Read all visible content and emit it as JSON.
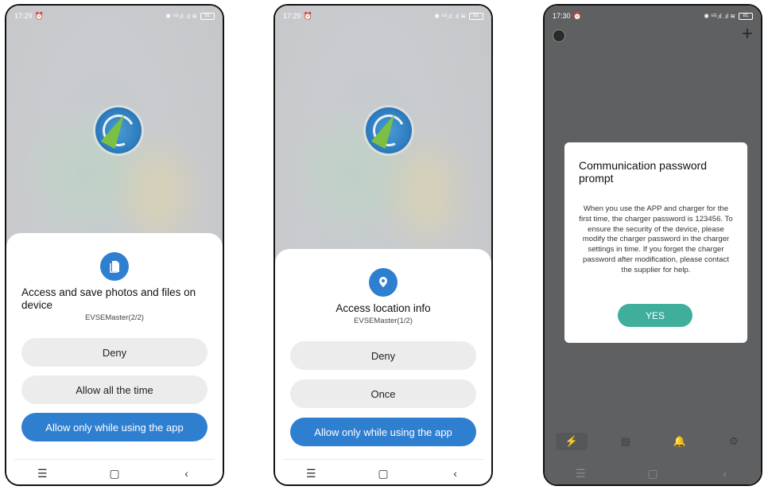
{
  "phone1": {
    "status": {
      "time": "17:29",
      "alarm_icon": "alarm-icon",
      "right": "✱ ⁵ᴳ.ıl .ıl ≋",
      "battery": "81"
    },
    "permission": {
      "icon": "file-icon",
      "title": "Access and save photos and files on device",
      "subtitle": "EVSEMaster(2/2)",
      "buttons": [
        "Deny",
        "Allow all the time",
        "Allow only while using the app"
      ]
    },
    "nav": {
      "menu": "☰",
      "home": "▢",
      "back": "‹"
    }
  },
  "phone2": {
    "status": {
      "time": "17:29",
      "alarm_icon": "alarm-icon",
      "right": "✱ ⁵ᴳ.ıl .ıl ≋",
      "battery": "81"
    },
    "permission": {
      "icon": "location-icon",
      "title": "Access location info",
      "subtitle": "EVSEMaster(1/2)",
      "buttons": [
        "Deny",
        "Once",
        "Allow only while using the app"
      ]
    },
    "nav": {
      "menu": "☰",
      "home": "▢",
      "back": "‹"
    }
  },
  "phone3": {
    "status": {
      "time": "17:30",
      "alarm_icon": "alarm-icon",
      "right": "✱ ⁵ᴳ.ıl .ıl ≋",
      "battery": "81"
    },
    "header": {
      "plus": "+"
    },
    "dialog": {
      "title": "Communication password prompt",
      "body": "When you use the APP and charger for the first time, the charger password is 123456. To ensure the security of the device, please modify the charger password in the charger settings in time. If you forget the charger password after modification, please contact the supplier for help.",
      "button": "YES"
    },
    "tabs": {
      "charge": "⚡",
      "records": "▤",
      "alerts": "🔔",
      "settings": "⚙"
    },
    "nav": {
      "menu": "☰",
      "home": "▢",
      "back": "‹"
    }
  },
  "colors": {
    "primary": "#2f7fd0",
    "accent": "#3fae9b",
    "dim": "#5f6061"
  }
}
